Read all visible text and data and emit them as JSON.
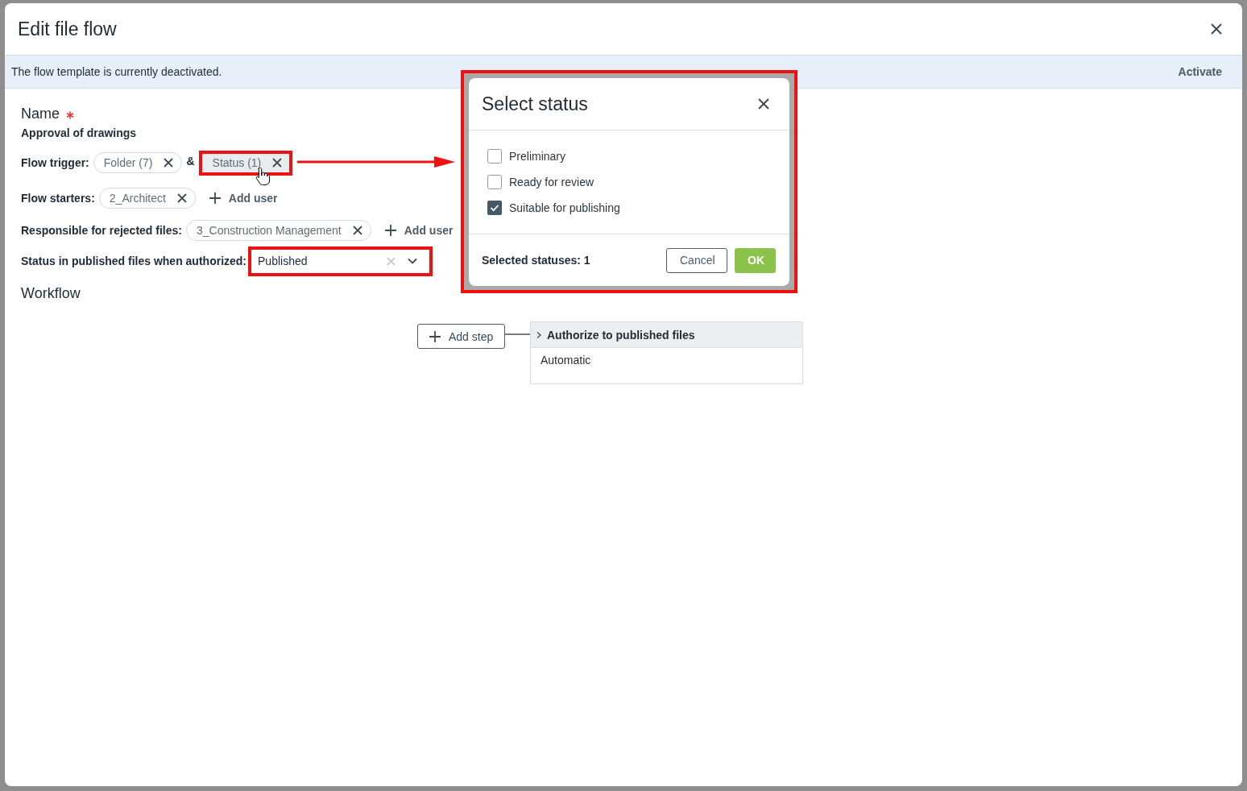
{
  "dialog": {
    "title": "Edit file flow"
  },
  "banner": {
    "message": "The flow template is currently deactivated.",
    "action": "Activate"
  },
  "name": {
    "label": "Name",
    "required": true,
    "value": "Approval of drawings"
  },
  "flow_trigger": {
    "label": "Flow trigger:",
    "joiner": "&",
    "chips": [
      {
        "label": "Folder (7)",
        "hovered": false,
        "highlighted": false
      },
      {
        "label": "Status (1)",
        "hovered": true,
        "highlighted": true
      }
    ]
  },
  "flow_starters": {
    "label": "Flow starters:",
    "chips": [
      {
        "label": "2_Architect"
      }
    ],
    "add_button": "Add user"
  },
  "rejected_responsible": {
    "label": "Responsible for rejected files:",
    "chips": [
      {
        "label": "3_Construction Management"
      }
    ],
    "add_button": "Add user"
  },
  "published_status": {
    "label": "Status in published files when authorized:",
    "value": "Published",
    "highlighted": true
  },
  "workflow": {
    "heading": "Workflow",
    "add_step": "Add step",
    "steps": [
      {
        "title": "Authorize to published files",
        "expanded": false,
        "detail": "Automatic"
      }
    ]
  },
  "status_popup": {
    "title": "Select status",
    "highlighted": true,
    "options": [
      {
        "label": "Preliminary",
        "checked": false
      },
      {
        "label": "Ready for review",
        "checked": false
      },
      {
        "label": "Suitable for publishing",
        "checked": true
      }
    ],
    "summary": "Selected statuses: 1",
    "buttons": [
      {
        "label": "Cancel",
        "kind": "secondary"
      },
      {
        "label": "OK",
        "kind": "primary"
      }
    ]
  },
  "annotation": {
    "arrow": true
  }
}
